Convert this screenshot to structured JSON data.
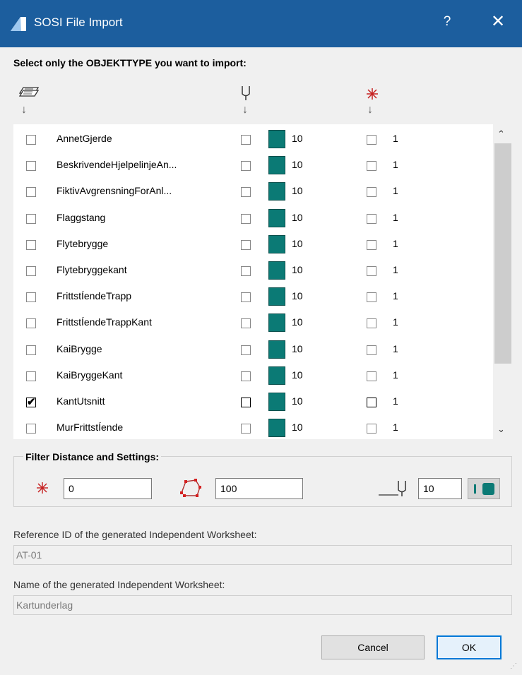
{
  "window": {
    "title": "SOSI File Import",
    "help_glyph": "?",
    "close_glyph": "✕"
  },
  "prompt": "Select only the OBJEKTTYPE you want to import:",
  "column_headers": {
    "layers_icon": "layers-icon",
    "pen_icon": "pen-icon",
    "point_icon": "point-icon",
    "arrow_glyph": "↓"
  },
  "rows": [
    {
      "name": "AnnetGjerde",
      "checked": false,
      "line_checked": false,
      "pen": "10",
      "point_checked": false,
      "point_value": "1"
    },
    {
      "name": "BeskrivendeHjelpelinjeAn...",
      "checked": false,
      "line_checked": false,
      "pen": "10",
      "point_checked": false,
      "point_value": "1"
    },
    {
      "name": "FiktivAvgrensningForAnl...",
      "checked": false,
      "line_checked": false,
      "pen": "10",
      "point_checked": false,
      "point_value": "1"
    },
    {
      "name": "Flaggstang",
      "checked": false,
      "line_checked": false,
      "pen": "10",
      "point_checked": false,
      "point_value": "1"
    },
    {
      "name": "Flytebrygge",
      "checked": false,
      "line_checked": false,
      "pen": "10",
      "point_checked": false,
      "point_value": "1"
    },
    {
      "name": "Flytebryggekant",
      "checked": false,
      "line_checked": false,
      "pen": "10",
      "point_checked": false,
      "point_value": "1"
    },
    {
      "name": "FrittstÍendeTrapp",
      "checked": false,
      "line_checked": false,
      "pen": "10",
      "point_checked": false,
      "point_value": "1"
    },
    {
      "name": "FrittstÍendeTrappKant",
      "checked": false,
      "line_checked": false,
      "pen": "10",
      "point_checked": false,
      "point_value": "1"
    },
    {
      "name": "KaiBrygge",
      "checked": false,
      "line_checked": false,
      "pen": "10",
      "point_checked": false,
      "point_value": "1"
    },
    {
      "name": "KaiBryggeKant",
      "checked": false,
      "line_checked": false,
      "pen": "10",
      "point_checked": false,
      "point_value": "1"
    },
    {
      "name": "KantUtsnitt",
      "checked": true,
      "line_checked": false,
      "pen": "10",
      "point_checked": false,
      "point_value": "1"
    },
    {
      "name": "MurFrittstÍende",
      "checked": false,
      "line_checked": false,
      "pen": "10",
      "point_checked": false,
      "point_value": "1"
    }
  ],
  "colors": {
    "accent": "#1c5e9e",
    "pen_swatch": "#0b7a75",
    "ok_border": "#0078d7"
  },
  "filter": {
    "legend": "Filter Distance and Settings:",
    "distance_value": "0",
    "polygon_value": "100",
    "pen_value": "10"
  },
  "reference": {
    "label": "Reference ID of the generated Independent Worksheet:",
    "value": "AT-01"
  },
  "worksheet_name": {
    "label": "Name of the generated Independent Worksheet:",
    "value": "Kartunderlag"
  },
  "buttons": {
    "cancel": "Cancel",
    "ok": "OK"
  }
}
